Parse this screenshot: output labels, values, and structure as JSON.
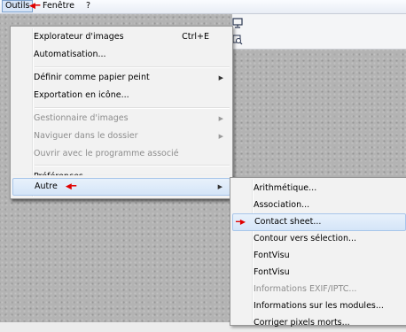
{
  "menubar": {
    "items": [
      "Outils",
      "Fenêtre",
      "?"
    ],
    "pointer_arrow": "◀━"
  },
  "menu_outils": {
    "explorer": {
      "label": "Explorateur d'images",
      "shortcut": "Ctrl+E"
    },
    "automation": "Automatisation...",
    "wallpaper": "Définir comme papier peint",
    "export_icon": "Exportation en icône...",
    "image_manager": "Gestionnaire d'images",
    "browse_folder": "Naviguer dans le dossier",
    "open_with": "Ouvrir avec le programme associé",
    "preferences": "Préférences...",
    "other": "Autre",
    "other_pointer": "◀━",
    "submenu_arrow": "▶"
  },
  "menu_autre": {
    "arithmetic": "Arithmétique...",
    "association": "Association...",
    "contact_sheet": "Contact sheet...",
    "contact_sheet_pointer": "━▶",
    "contour": "Contour vers sélection...",
    "fontvisu_1": "FontVisu",
    "fontvisu_2": "FontVisu",
    "exif_info": "Informations EXIF/IPTC...",
    "modules_info": "Informations sur les modules...",
    "dead_pixels": "Corriger pixels morts..."
  },
  "colors": {
    "accent_red": "#e00000",
    "highlight": "#d4e5f8",
    "disabled_text": "#8d8d8d"
  }
}
